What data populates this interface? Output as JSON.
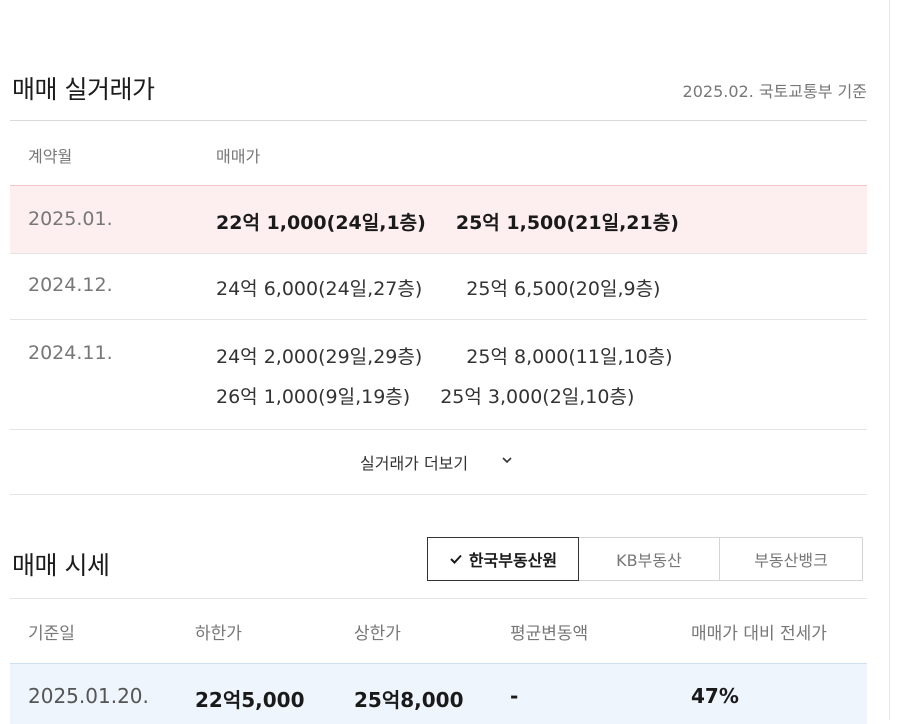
{
  "trade": {
    "title": "매매 실거래가",
    "source": "2025.02. 국토교통부 기준",
    "headers": {
      "month": "계약월",
      "price": "매매가"
    },
    "rows": [
      {
        "month": "2025.01.",
        "lines": [
          [
            "22억 1,000(24일,1층)",
            "25억 1,500(21일,21층)"
          ]
        ]
      },
      {
        "month": "2024.12.",
        "lines": [
          [
            "24억 6,000(24일,27층)",
            "25억 6,500(20일,9층)"
          ]
        ]
      },
      {
        "month": "2024.11.",
        "lines": [
          [
            "24억 2,000(29일,29층)",
            "25억 8,000(11일,10층)"
          ],
          [
            "26억 1,000(9일,19층)",
            "25억 3,000(2일,10층)"
          ]
        ]
      }
    ],
    "more_label": "실거래가 더보기"
  },
  "market": {
    "title": "매매 시세",
    "tabs": [
      "한국부동산원",
      "KB부동산",
      "부동산뱅크"
    ],
    "active_tab": "한국부동산원",
    "headers": [
      "기준일",
      "하한가",
      "상한가",
      "평균변동액",
      "매매가 대비 전세가"
    ],
    "row": {
      "date": "2025.01.20.",
      "low": "22억5,000",
      "high": "25억8,000",
      "avg_change": "-",
      "ratio": "47%"
    }
  },
  "icons": {
    "more": "chevron-down-icon",
    "active_tab": "check-icon"
  },
  "colors": {
    "highlight_row": "#fdeff0",
    "market_row": "#eef5fc",
    "muted_text": "#777777"
  }
}
